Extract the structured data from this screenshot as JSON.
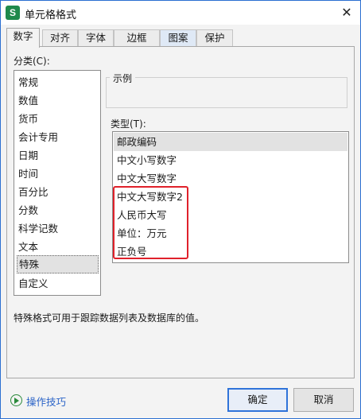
{
  "window": {
    "title": "单元格格式",
    "app_icon_letter": "S",
    "close_glyph": "✕"
  },
  "tabs": [
    {
      "label": "数字",
      "active": true
    },
    {
      "label": "对齐"
    },
    {
      "label": "字体"
    },
    {
      "label": "边框"
    },
    {
      "label": "图案"
    },
    {
      "label": "保护"
    }
  ],
  "category": {
    "label": "分类(C):",
    "items": [
      "常规",
      "数值",
      "货币",
      "会计专用",
      "日期",
      "时间",
      "百分比",
      "分数",
      "科学记数",
      "文本",
      "特殊",
      "自定义"
    ],
    "selected": "特殊"
  },
  "sample": {
    "label": "示例"
  },
  "type": {
    "label": "类型(T):",
    "items": [
      "邮政编码",
      "中文小写数字",
      "中文大写数字",
      "中文大写数字2",
      "人民币大写",
      "单位：万元",
      "正负号"
    ],
    "selected": "邮政编码"
  },
  "description": "特殊格式可用于跟踪数据列表及数据库的值。",
  "footer": {
    "tips_label": "操作技巧",
    "ok_label": "确定",
    "cancel_label": "取消"
  },
  "colors": {
    "accent": "#2f73d9",
    "highlight": "#e0212b",
    "link": "#2a63c7"
  }
}
